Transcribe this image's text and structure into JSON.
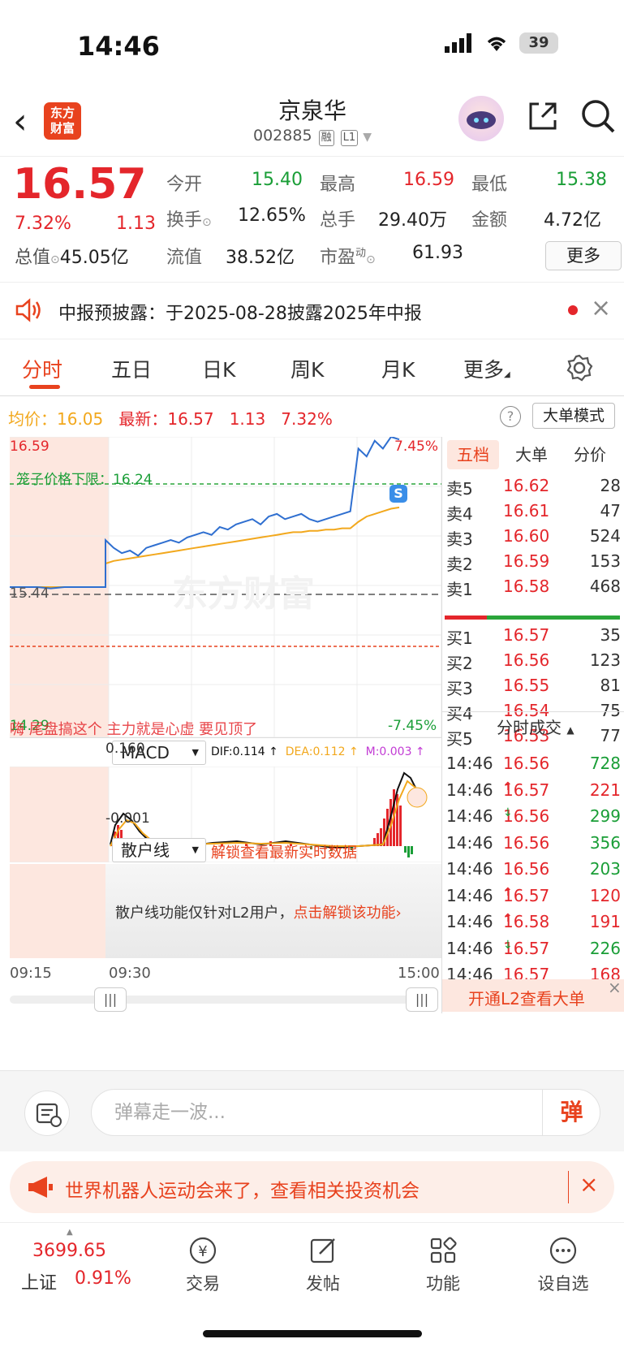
{
  "status": {
    "time": "14:46",
    "battery": "39"
  },
  "header": {
    "back": "‹",
    "logo_text": "东方\n财富",
    "title": "京泉华",
    "code": "002885",
    "tag_margin": "融",
    "tag_level": "L1"
  },
  "quote": {
    "price": "16.57",
    "change_pct": "7.32%",
    "change": "1.13",
    "open_label": "今开",
    "open": "15.40",
    "high_label": "最高",
    "high": "16.59",
    "low_label": "最低",
    "low": "15.38",
    "turnover_label": "换手",
    "turnover": "12.65%",
    "volume_label": "总手",
    "volume": "29.40万",
    "amount_label": "金额",
    "amount": "4.72亿",
    "mktcap_label": "总值",
    "mktcap": "45.05亿",
    "float_label": "流值",
    "float_cap": "38.52亿",
    "pe_label": "市盈",
    "pe_sup": "动",
    "pe": "61.93",
    "more": "更多"
  },
  "notice": {
    "text": "中报预披露：于2025-08-28披露2025年中报",
    "close": "×"
  },
  "tabs": [
    {
      "label": "分时"
    },
    {
      "label": "五日"
    },
    {
      "label": "日K"
    },
    {
      "label": "周K"
    },
    {
      "label": "月K"
    },
    {
      "label": "更多"
    }
  ],
  "infobar": {
    "avg_label": "均价：",
    "avg": "16.05",
    "last_label": "最新：",
    "last": "16.57",
    "chg": "1.13",
    "pct": "7.32%",
    "help": "?",
    "mode_btn": "大单模式"
  },
  "chart": {
    "y_top": "16.59",
    "y_mid": "15.44",
    "y_bottom": "14.29",
    "pct_top": "7.45%",
    "pct_bottom": "-7.45%",
    "cage_label": "笼子价格下限：16.24",
    "watermark": "东方财富",
    "danmaku": "嗨  尾盘搞这个   主力就是心虚    要见顶了",
    "s_marker": "S"
  },
  "chart_data": {
    "type": "line",
    "title": "",
    "xlabel": "",
    "ylabel": "",
    "x_ticks": [
      "09:15",
      "09:30",
      "15:00"
    ],
    "ylim": [
      14.29,
      16.59
    ],
    "series": [
      {
        "name": "",
        "color": "#2f6fd0",
        "values": [
          15.44,
          15.44,
          15.44,
          15.43,
          15.44,
          15.44,
          15.44,
          15.44,
          15.8,
          15.74,
          15.7,
          15.72,
          15.68,
          15.74,
          15.76,
          15.78,
          15.8,
          15.78,
          15.82,
          15.84,
          15.86,
          15.84,
          15.9,
          15.88,
          15.92,
          15.94,
          15.96,
          15.92,
          15.98,
          16.0,
          15.96,
          15.98,
          16.0,
          15.96,
          15.94,
          15.96,
          15.98,
          16.0,
          16.02,
          16.5,
          16.44,
          16.56,
          16.5,
          16.59,
          16.57
        ]
      },
      {
        "name": "",
        "color": "#f2a81d",
        "values": [
          15.44,
          15.44,
          15.44,
          15.44,
          15.44,
          15.44,
          15.44,
          15.44,
          15.62,
          15.64,
          15.65,
          15.66,
          15.67,
          15.68,
          15.69,
          15.7,
          15.71,
          15.72,
          15.73,
          15.74,
          15.75,
          15.76,
          15.77,
          15.78,
          15.79,
          15.8,
          15.81,
          15.82,
          15.83,
          15.84,
          15.85,
          15.86,
          15.86,
          15.87,
          15.87,
          15.88,
          15.88,
          15.89,
          15.89,
          15.94,
          15.98,
          16.0,
          16.02,
          16.04,
          16.05
        ]
      }
    ]
  },
  "macd": {
    "label": "MACD",
    "dif": "DIF:0.114 ↑",
    "dea": "DEA:0.112 ↑",
    "m": "M:0.003 ↑",
    "top": "0.160",
    "bottom": "-0.001"
  },
  "retail": {
    "label": "散户线",
    "unlock": "解锁查看最新实时数据",
    "msg": "散户线功能仅针对L2用户，",
    "msg_link": "点击解锁该功能›"
  },
  "time_axis": {
    "t0": "09:15",
    "t1": "09:30",
    "t2": "15:00"
  },
  "book": {
    "tabs": [
      "五档",
      "大单",
      "分价"
    ],
    "asks": [
      {
        "label": "卖5",
        "price": "16.62",
        "vol": "28"
      },
      {
        "label": "卖4",
        "price": "16.61",
        "vol": "47"
      },
      {
        "label": "卖3",
        "price": "16.60",
        "vol": "524"
      },
      {
        "label": "卖2",
        "price": "16.59",
        "vol": "153"
      },
      {
        "label": "卖1",
        "price": "16.58",
        "vol": "468"
      }
    ],
    "bids": [
      {
        "label": "买1",
        "price": "16.57",
        "vol": "35"
      },
      {
        "label": "买2",
        "price": "16.56",
        "vol": "123"
      },
      {
        "label": "买3",
        "price": "16.55",
        "vol": "81"
      },
      {
        "label": "买4",
        "price": "16.54",
        "vol": "75"
      },
      {
        "label": "买5",
        "price": "16.53",
        "vol": "77"
      }
    ]
  },
  "trades": {
    "title": "分时成交",
    "rows": [
      {
        "time": "14:46",
        "price": "16.56",
        "dir": "",
        "vol": "728",
        "vcolor": "#1a9e37"
      },
      {
        "time": "14:46",
        "price": "16.57",
        "dir": "↑",
        "vol": "221",
        "vcolor": "#e4262b"
      },
      {
        "time": "14:46",
        "price": "16.56",
        "dir": "↓",
        "vol": "299",
        "vcolor": "#1a9e37"
      },
      {
        "time": "14:46",
        "price": "16.56",
        "dir": "",
        "vol": "356",
        "vcolor": "#1a9e37"
      },
      {
        "time": "14:46",
        "price": "16.56",
        "dir": "",
        "vol": "203",
        "vcolor": "#1a9e37"
      },
      {
        "time": "14:46",
        "price": "16.57",
        "dir": "↑",
        "vol": "120",
        "vcolor": "#e4262b"
      },
      {
        "time": "14:46",
        "price": "16.58",
        "dir": "↑",
        "vol": "191",
        "vcolor": "#e4262b"
      },
      {
        "time": "14:46",
        "price": "16.57",
        "dir": "↓",
        "vol": "226",
        "vcolor": "#1a9e37"
      },
      {
        "time": "14:46",
        "price": "16.57",
        "dir": "",
        "vol": "168",
        "vcolor": "#e4262b"
      }
    ],
    "l2_prompt": "开通L2查看大单"
  },
  "comment": {
    "placeholder": "弹幕走一波...",
    "send": "弹"
  },
  "banner": {
    "text": "世界机器人运动会来了，查看相关投资机会",
    "close": "×"
  },
  "footer": {
    "index_value": "3699.65",
    "index_name": "上证",
    "index_pct": "0.91%",
    "items": [
      {
        "label": "交易"
      },
      {
        "label": "发帖"
      },
      {
        "label": "功能"
      },
      {
        "label": "设自选"
      }
    ]
  }
}
